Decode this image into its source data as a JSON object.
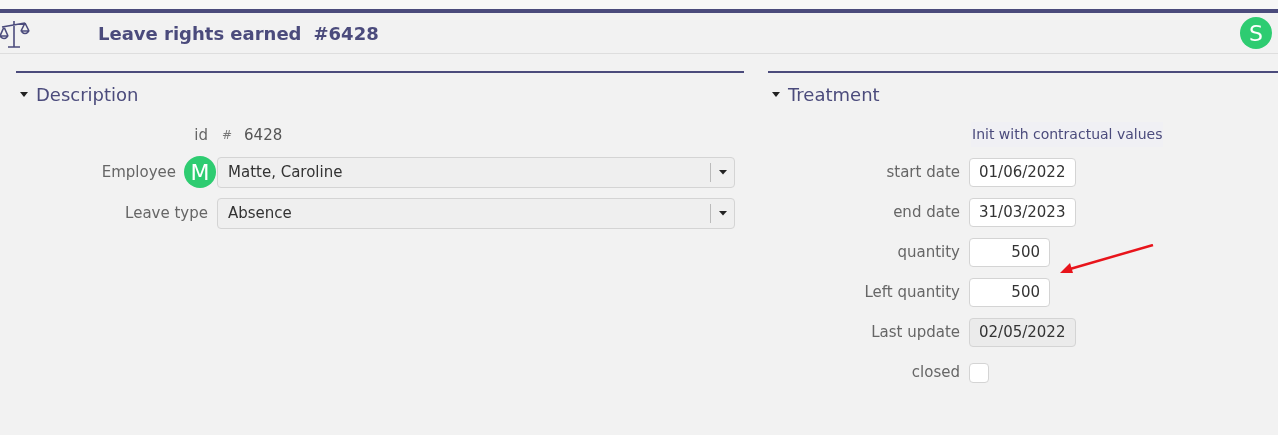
{
  "header": {
    "title": "Leave rights earned",
    "number": "#6428",
    "user_initial": "S"
  },
  "description": {
    "title": "Description",
    "expanded": true,
    "id": {
      "label": "id",
      "symbol": "#",
      "value": "6428"
    },
    "fields": [
      {
        "label": "Employee",
        "value": "Matte, Caroline",
        "avatar": "M"
      },
      {
        "label": "Leave type",
        "value": "Absence"
      }
    ]
  },
  "treatment": {
    "title": "Treatment",
    "expanded": true,
    "action": "Init with contractual values",
    "fields": [
      {
        "kind": "date",
        "label": "start date",
        "value": "01/06/2022"
      },
      {
        "kind": "date",
        "label": "end date",
        "value": "31/03/2023"
      },
      {
        "kind": "number",
        "label": "quantity",
        "value": "500"
      },
      {
        "kind": "number",
        "label": "Left quantity",
        "value": "500"
      },
      {
        "kind": "readonly",
        "label": "Last update",
        "value": "02/05/2022"
      },
      {
        "kind": "checkbox",
        "label": "closed",
        "checked": false
      }
    ]
  }
}
